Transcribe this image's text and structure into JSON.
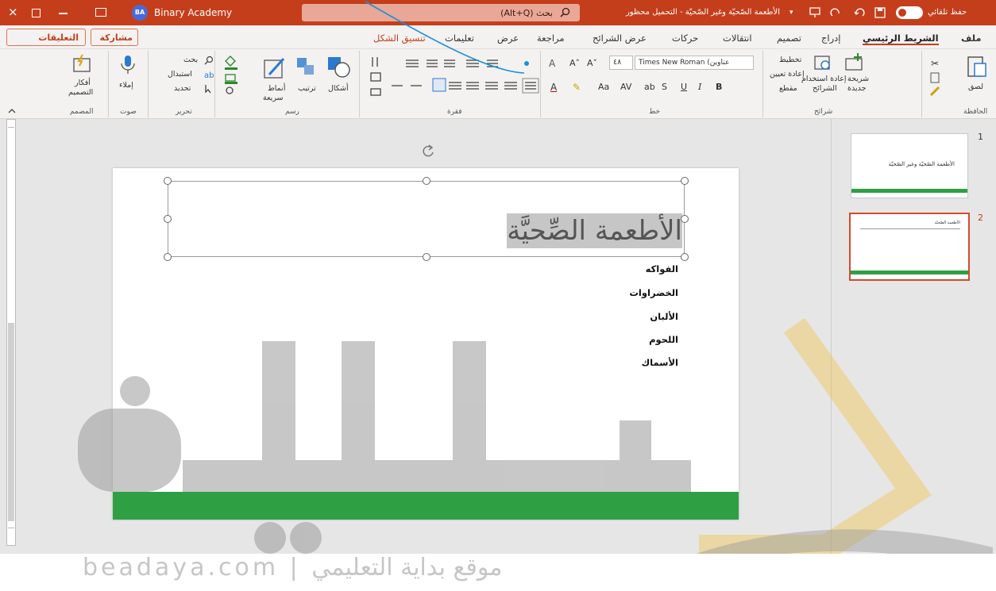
{
  "titlebar": {
    "autosave": "حفظ تلقائي",
    "doc_title": "الأطعمة الصّحيّة وغير الصّحيّة  -  التحميل محظور",
    "search_placeholder": "بحث (Alt+Q)",
    "avatar_initials": "BA",
    "account": "Binary Academy",
    "close_glyph": "×"
  },
  "tabs": [
    {
      "label": "ملف"
    },
    {
      "label": "الشريط الرئيسي"
    },
    {
      "label": "إدراج"
    },
    {
      "label": "تصميم"
    },
    {
      "label": "انتقالات"
    },
    {
      "label": "حركات"
    },
    {
      "label": "عرض الشرائح"
    },
    {
      "label": "مراجعة"
    },
    {
      "label": "عرض"
    },
    {
      "label": "تعليمات"
    },
    {
      "label": "تنسيق الشكل"
    }
  ],
  "actions": {
    "share": "مشاركة",
    "comments": "التعليقات"
  },
  "ribbon": {
    "clipboard": {
      "paste": "لصق",
      "label": "الحافظة"
    },
    "slides": {
      "new_line1": "شريحة",
      "new_line2": "جديدة",
      "reuse_line1": "إعادة استخدام",
      "reuse_line2": "الشرائح",
      "layout": "تخطيط",
      "reset": "إعادة تعيين",
      "section": "مقطع",
      "label": "شرائح"
    },
    "font": {
      "name": "Times New Roman (عناوين",
      "size": "٤٨",
      "bold": "B",
      "italic": "I",
      "underline": "U",
      "strike": "S",
      "label": "خط"
    },
    "paragraph": {
      "label": "فقرة"
    },
    "drawing": {
      "shapes": "أشكال",
      "arrange": "ترتيب",
      "styles_line1": "أنماط",
      "styles_line2": "سريعة",
      "label": "رسم"
    },
    "editing": {
      "find": "بحث",
      "replace": "استبدال",
      "select": "تحديد",
      "label": "تحرير"
    },
    "voice": {
      "dictate": "إملاء",
      "label": "صوت"
    },
    "designer": {
      "ideas_line1": "أفكار",
      "ideas_line2": "التصميم",
      "label": "المصمم"
    }
  },
  "slide": {
    "title": "الأطعمة الصِّحيَّة",
    "bullets": [
      "الفواكه",
      "الخضراوات",
      "الألبان",
      "اللحوم",
      "الأسماك"
    ]
  },
  "thumbnails": [
    {
      "number": "1",
      "title": "الأطعمة الصّحيّة وغير الصّحيّة"
    },
    {
      "number": "2",
      "title": "الأطعمة الصّحيّة"
    }
  ],
  "watermark": {
    "brand": "بداية",
    "caption": "beadaya.com  |  موقع بداية التعليمي"
  },
  "colors": {
    "accent": "#c43e1c",
    "slide_band": "#2ea043",
    "annotation": "#1e90d8"
  }
}
